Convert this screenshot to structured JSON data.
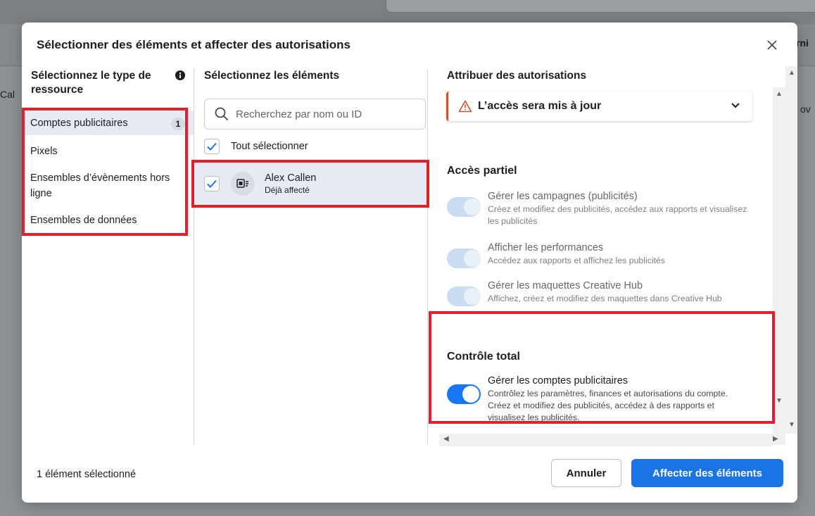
{
  "background": {
    "left_fragment": "Cal",
    "right_fragment_top": "rni",
    "right_fragment_mid": "ov"
  },
  "modal": {
    "title": "Sélectionner des éléments et affecter des autorisations",
    "close_icon": "close-icon"
  },
  "resource_types": {
    "header": "Sélectionnez le type de ressource",
    "info_icon": "info-icon",
    "items": [
      {
        "label": "Comptes publicitaires",
        "badge": "1",
        "active": true
      },
      {
        "label": "Pixels"
      },
      {
        "label": "Ensembles d’évènements hors ligne"
      },
      {
        "label": "Ensembles de données"
      }
    ]
  },
  "assets": {
    "header": "Sélectionnez les éléments",
    "search_placeholder": "Recherchez par nom ou ID",
    "select_all_label": "Tout sélectionner",
    "items": [
      {
        "name": "Alex Callen",
        "status": "Déjà affecté",
        "checked": true,
        "icon": "ad-account-icon"
      }
    ]
  },
  "permissions": {
    "header": "Attribuer des autorisations",
    "warning": {
      "text": "L’accès sera mis à jour",
      "icon": "warning-icon",
      "color": "#c8562f"
    },
    "partial": {
      "title": "Accès partiel",
      "items": [
        {
          "name": "Gérer les campagnes (publicités)",
          "desc": "Créez et modifiez des publicités, accédez aux rapports et visualisez les publicités",
          "enabled": false
        },
        {
          "name": "Afficher les performances",
          "desc": "Accédez aux rapports et affichez les publicités",
          "enabled": false
        },
        {
          "name": "Gérer les maquettes Creative Hub",
          "desc": "Affichez, créez et modifiez des maquettes dans Creative Hub",
          "enabled": false
        }
      ]
    },
    "full": {
      "title": "Contrôle total",
      "items": [
        {
          "name": "Gérer les comptes publicitaires",
          "desc": "Contrôlez les paramètres, finances et autorisations du compte. Créez et modifiez des publicités, accédez à des rapports et visualisez les publicités.",
          "enabled": true
        }
      ]
    }
  },
  "footer": {
    "selection_count": "1 élément sélectionné",
    "cancel_label": "Annuler",
    "confirm_label": "Affecter des éléments"
  },
  "colors": {
    "primary": "#1b74e4",
    "highlight": "#e41e2b",
    "selected_row": "#e7ecf3"
  }
}
